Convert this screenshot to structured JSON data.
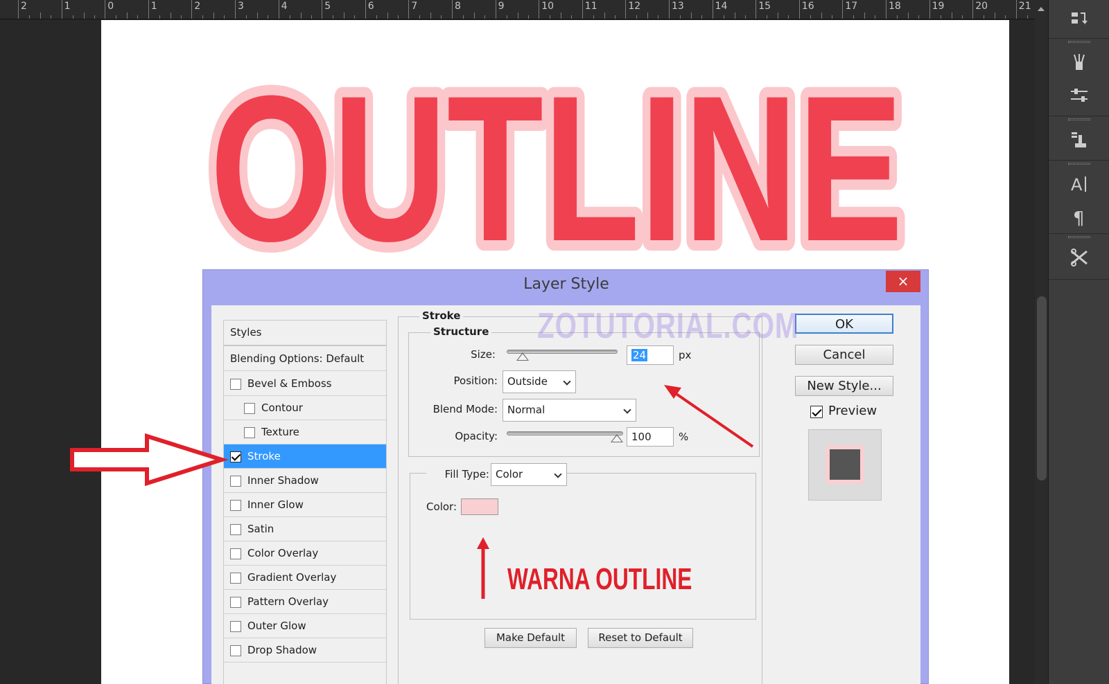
{
  "ruler": {
    "labels": [
      "2",
      "1",
      "0",
      "1",
      "2",
      "3",
      "4",
      "5",
      "6",
      "7",
      "8",
      "9",
      "10",
      "11",
      "12",
      "13",
      "14",
      "15",
      "16",
      "17",
      "18",
      "19",
      "20",
      "21"
    ]
  },
  "canvas": {
    "text": "OUTLINE",
    "fill_color": "#f04150",
    "stroke_color": "#fbc7cb"
  },
  "tool_panel": {
    "icons": [
      "panel-swap-icon",
      "brush-presets-icon",
      "adjust-sliders-icon",
      "clone-source-icon",
      "character-icon",
      "paragraph-icon",
      "tool-presets-icon"
    ]
  },
  "dialog": {
    "title": "Layer Style",
    "close_label": "×",
    "styles_list": {
      "header": "Styles",
      "blending": "Blending Options: Default",
      "items": [
        {
          "label": "Bevel & Emboss",
          "checked": false,
          "indent": false
        },
        {
          "label": "Contour",
          "checked": false,
          "indent": true
        },
        {
          "label": "Texture",
          "checked": false,
          "indent": true
        },
        {
          "label": "Stroke",
          "checked": true,
          "indent": false,
          "active": true
        },
        {
          "label": "Inner Shadow",
          "checked": false,
          "indent": false
        },
        {
          "label": "Inner Glow",
          "checked": false,
          "indent": false
        },
        {
          "label": "Satin",
          "checked": false,
          "indent": false
        },
        {
          "label": "Color Overlay",
          "checked": false,
          "indent": false
        },
        {
          "label": "Gradient Overlay",
          "checked": false,
          "indent": false
        },
        {
          "label": "Pattern Overlay",
          "checked": false,
          "indent": false
        },
        {
          "label": "Outer Glow",
          "checked": false,
          "indent": false
        },
        {
          "label": "Drop Shadow",
          "checked": false,
          "indent": false
        }
      ]
    },
    "stroke": {
      "title": "Stroke",
      "structure_title": "Structure",
      "size_label": "Size:",
      "size_value": "24",
      "size_unit": "px",
      "size_fraction": 0.1,
      "position_label": "Position:",
      "position_value": "Outside",
      "blend_label": "Blend Mode:",
      "blend_value": "Normal",
      "opacity_label": "Opacity:",
      "opacity_value": "100",
      "opacity_unit": "%",
      "opacity_fraction": 1.0,
      "fill_type_label": "Fill Type:",
      "fill_type_value": "Color",
      "color_label": "Color:",
      "color_value": "#f9cfd2",
      "make_default": "Make Default",
      "reset_default": "Reset to Default"
    },
    "buttons": {
      "ok": "OK",
      "cancel": "Cancel",
      "new_style": "New Style..."
    },
    "preview": {
      "label": "Preview",
      "checked": true
    }
  },
  "watermark": "ZOTUTORIAL.COM",
  "annotation": {
    "text": "WARNA OUTLINE",
    "color": "#e0202a"
  }
}
